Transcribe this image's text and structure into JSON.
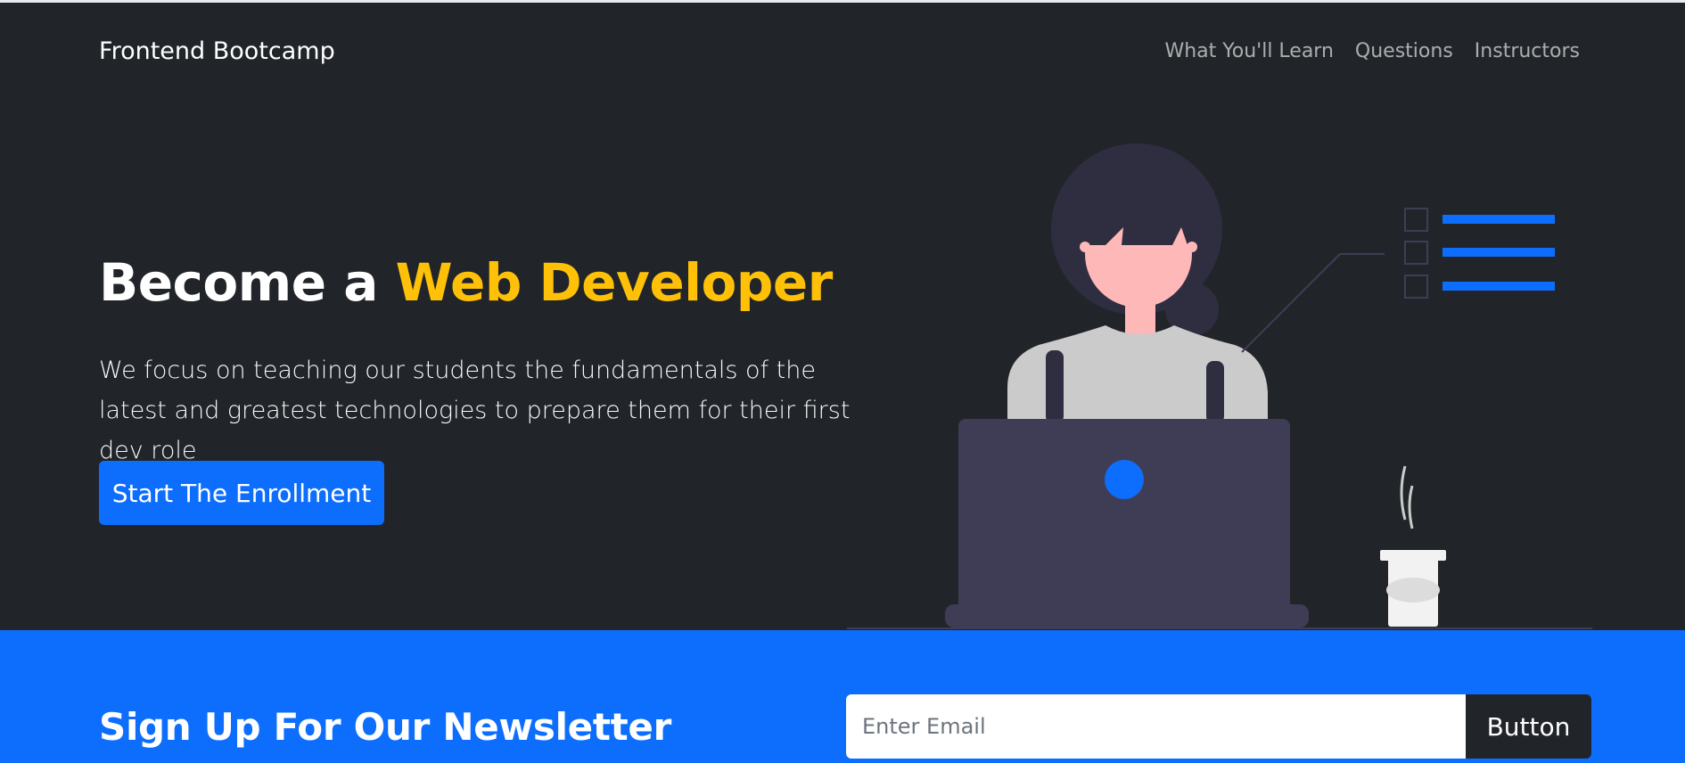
{
  "nav": {
    "brand": "Frontend Bootcamp",
    "links": [
      "What You'll Learn",
      "Questions",
      "Instructors"
    ]
  },
  "hero": {
    "title_prefix": "Become a ",
    "title_accent": "Web Developer",
    "lead": "We focus on teaching our students the fundamentals of the latest and greatest technologies to prepare them for their first dev role",
    "cta_label": "Start The Enrollment"
  },
  "newsletter": {
    "title": "Sign Up For Our Newsletter",
    "email_placeholder": "Enter Email",
    "button_label": "Button"
  },
  "colors": {
    "dark": "#212529",
    "primary": "#0d6efd",
    "warning": "#ffc107"
  },
  "illustration": {
    "name": "woman-at-laptop-illustration"
  }
}
